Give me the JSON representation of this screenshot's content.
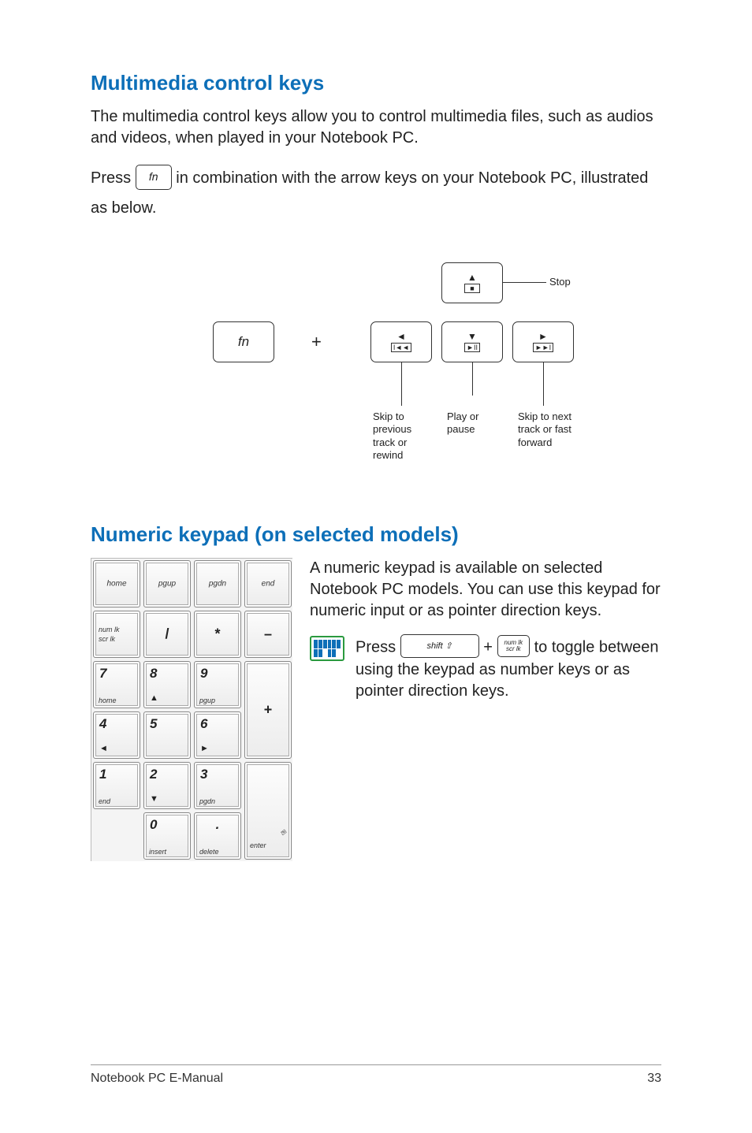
{
  "sections": {
    "multimedia": {
      "heading": "Multimedia control keys",
      "intro": "The multimedia control keys allow you to control multimedia files, such as audios and videos, when played in your Notebook PC.",
      "press_before": "Press",
      "fn_label": "fn",
      "press_after": "in combination with the arrow keys on your Notebook PC, illustrated as below.",
      "diagram": {
        "fn": "fn",
        "plus": "+",
        "stop": "Stop",
        "skip_prev": "Skip to previous track or rewind",
        "play_pause": "Play or pause",
        "skip_next": "Skip to next track or fast forward"
      }
    },
    "numeric": {
      "heading": "Numeric keypad (on selected models)",
      "intro": "A numeric keypad is available on selected Notebook PC models. You can use this keypad for numeric input or as pointer direction keys.",
      "note_press": "Press",
      "shift_label": "shift ⇧",
      "plus": "+",
      "numlk_top": "num lk",
      "numlk_bot": "scr lk",
      "note_to": "to",
      "note_rest": "toggle between using the keypad as number keys or as pointer direction keys.",
      "keypad": {
        "r1": [
          "home",
          "pgup",
          "pgdn",
          "end"
        ],
        "r2_numlk_top": "num lk",
        "r2_numlk_bot": "scr lk",
        "slash": "/",
        "star": "*",
        "minus": "–",
        "k7": "7",
        "k7_sub": "home",
        "k8": "8",
        "k8_sym": "▲",
        "k9": "9",
        "k9_sub": "pgup",
        "plus": "+",
        "k4": "4",
        "k4_sym": "◄",
        "k5": "5",
        "k6": "6",
        "k6_sym": "►",
        "k1": "1",
        "k1_sub": "end",
        "k2": "2",
        "k2_sym": "▼",
        "k3": "3",
        "k3_sub": "pgdn",
        "enter": "enter",
        "k0": "0",
        "k0_sub": "insert",
        "dot": ".",
        "dot_sub": "delete"
      }
    }
  },
  "footer": {
    "title": "Notebook PC E-Manual",
    "page": "33"
  }
}
